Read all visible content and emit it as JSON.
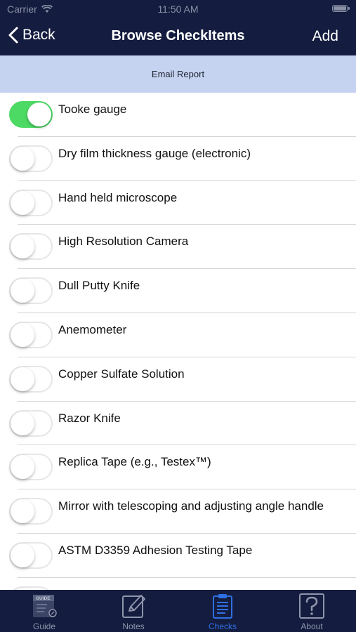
{
  "status_bar": {
    "carrier": "Carrier",
    "time": "11:50 AM"
  },
  "nav": {
    "back_label": "Back",
    "title": "Browse CheckItems",
    "add_label": "Add"
  },
  "email_report": {
    "label": "Email Report"
  },
  "items": [
    {
      "label": "Tooke gauge",
      "checked": true
    },
    {
      "label": "Dry film thickness gauge (electronic)",
      "checked": false
    },
    {
      "label": "Hand held microscope",
      "checked": false
    },
    {
      "label": "High Resolution Camera",
      "checked": false
    },
    {
      "label": "Dull Putty Knife",
      "checked": false
    },
    {
      "label": "Anemometer",
      "checked": false
    },
    {
      "label": "Copper Sulfate Solution",
      "checked": false
    },
    {
      "label": "Razor Knife",
      "checked": false
    },
    {
      "label": "Replica Tape (e.g., Testex™)",
      "checked": false
    },
    {
      "label": "Mirror with telescoping and adjusting angle handle",
      "checked": false
    },
    {
      "label": "ASTM D3359 Adhesion Testing Tape",
      "checked": false
    },
    {
      "label": "",
      "checked": false
    }
  ],
  "tabs": [
    {
      "label": "Guide",
      "icon": "guide-icon",
      "active": false
    },
    {
      "label": "Notes",
      "icon": "notes-icon",
      "active": false
    },
    {
      "label": "Checks",
      "icon": "checks-icon",
      "active": true
    },
    {
      "label": "About",
      "icon": "about-icon",
      "active": false
    }
  ],
  "colors": {
    "nav_bg": "#141d3f",
    "email_bar_bg": "#c5d3f0",
    "toggle_on": "#4cd964",
    "tab_active": "#2f6fe4"
  }
}
